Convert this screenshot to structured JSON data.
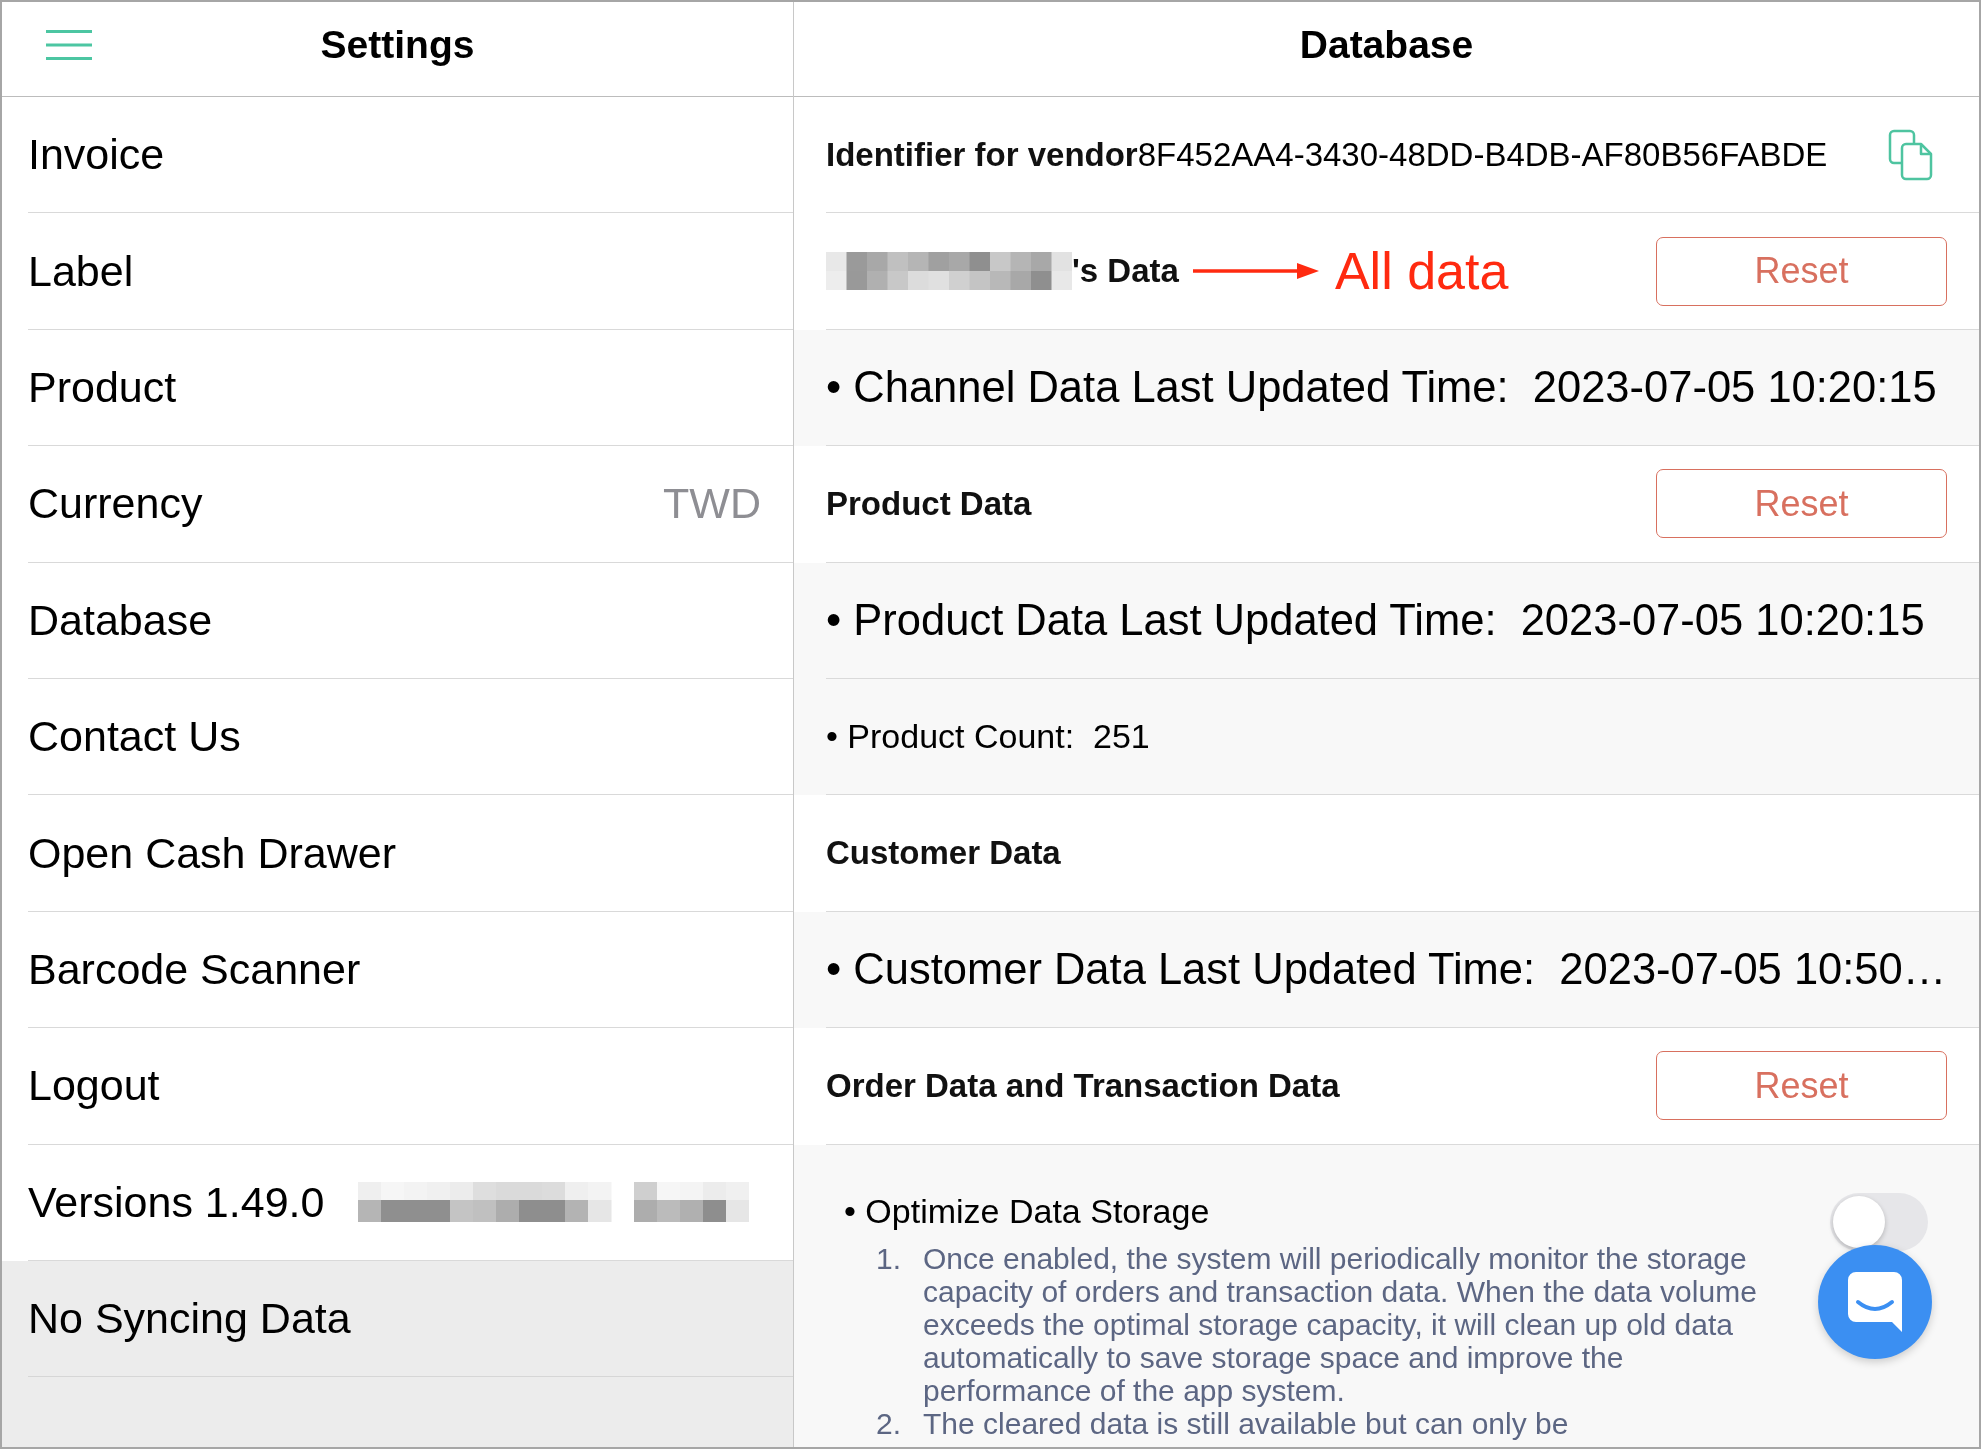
{
  "settings": {
    "title": "Settings",
    "items": [
      {
        "label": "Invoice"
      },
      {
        "label": "Label"
      },
      {
        "label": "Product"
      },
      {
        "label": "Currency",
        "value": "TWD"
      },
      {
        "label": "Database"
      },
      {
        "label": "Contact Us"
      },
      {
        "label": "Open Cash Drawer"
      },
      {
        "label": "Barcode Scanner"
      },
      {
        "label": "Logout"
      },
      {
        "label": "Versions 1.49.0",
        "redacted": true
      }
    ],
    "footer": "No Syncing Data"
  },
  "database": {
    "title": "Database",
    "rows": [
      {
        "kind": "identifier",
        "label": "Identifier for vendor",
        "value": "8F452AA4-3430-48DD-B4DB-AF80B56FABDE"
      },
      {
        "kind": "section",
        "label": "'s Data",
        "redacted": true,
        "annotation": "All data",
        "action": "Reset"
      },
      {
        "kind": "detail",
        "text": "• Channel Data Last Updated Time:  2023-07-05 10:20:15"
      },
      {
        "kind": "section",
        "label": "Product Data",
        "action": "Reset"
      },
      {
        "kind": "detail",
        "text": "• Product Data Last Updated Time:  2023-07-05 10:20:15"
      },
      {
        "kind": "note",
        "text": "• Product Count:  251"
      },
      {
        "kind": "section",
        "label": "Customer Data"
      },
      {
        "kind": "detail",
        "text": "• Customer Data Last Updated Time:  2023-07-05 10:50…"
      },
      {
        "kind": "section",
        "label": "Order Data and Transaction Data",
        "action": "Reset"
      },
      {
        "kind": "setting",
        "label": "• Optimize Data Storage",
        "on": false,
        "notes": [
          {
            "number": "1.",
            "text": "Once enabled, the system will periodically monitor the storage capacity of orders and transaction data. When the data volume exceeds the optimal storage capacity, it will clean up old data automatically to save storage space and improve the performance of the app system."
          },
          {
            "number": "2.",
            "text": "The cleared data is still available but can only be"
          }
        ]
      }
    ]
  }
}
